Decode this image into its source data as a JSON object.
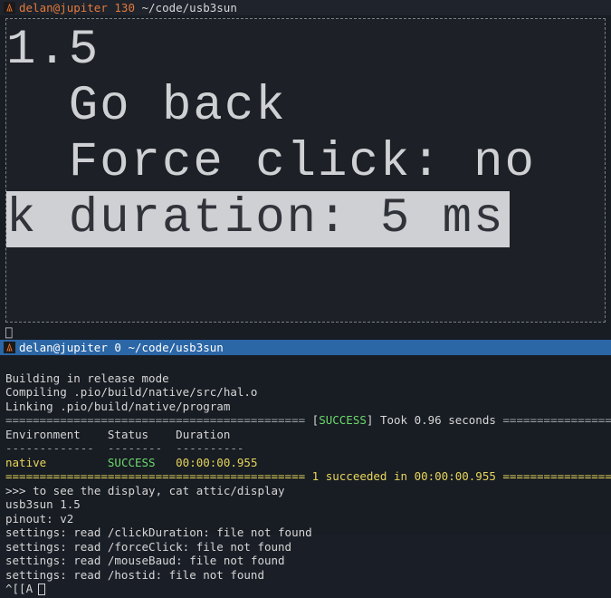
{
  "top_title": {
    "user": "delan",
    "host": "jupiter",
    "num": "130",
    "path": "~/code/usb3sun"
  },
  "display": {
    "version": "1.5",
    "item1": "  Go back",
    "item2": "  Force click: no",
    "item3_sel": "k duration: 5 ms"
  },
  "below_frame_glyph": "⎕",
  "bottom_title": {
    "user": "delan",
    "host": "jupiter",
    "num": "0",
    "path": "~/code/usb3sun"
  },
  "build": {
    "l1": "Building in release mode",
    "l2": "Compiling .pio/build/native/src/hal.o",
    "l3": "Linking .pio/build/native/program"
  },
  "status_bar": {
    "eq_left": "============================================",
    "label_open": " [",
    "success": "SUCCESS",
    "label_close": "] Took 0.96 seconds ",
    "eq_right": "=============================="
  },
  "table": {
    "hdr_env": "Environment",
    "hdr_status": "Status",
    "hdr_dur": "Duration",
    "dash_env": "-------------",
    "dash_status": "--------",
    "dash_dur": "----------",
    "row_env": "native",
    "row_status": "SUCCESS",
    "row_dur": "00:00:00.955"
  },
  "summary": {
    "eq_left": "============================================",
    "text_a": " 1 succeeded in ",
    "time": "00:00:00.955",
    "text_b": " ",
    "eq_right": "========================="
  },
  "tail": {
    "l1": ">>> to see the display, cat attic/display",
    "l2": "usb3sun 1.5",
    "l3": "pinout: v2",
    "l4": "settings: read /clickDuration: file not found",
    "l5": "settings: read /forceClick: file not found",
    "l6": "settings: read /mouseBaud: file not found",
    "l7": "settings: read /hostid: file not found",
    "l8": "^[[A"
  }
}
